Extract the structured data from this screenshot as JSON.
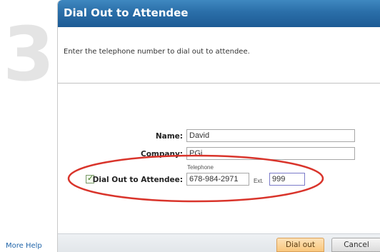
{
  "step": "3",
  "dialog": {
    "title": "Dial Out to Attendee",
    "instruction": "Enter the telephone number to dial out to attendee."
  },
  "form": {
    "name": {
      "label": "Name:",
      "value": "David"
    },
    "company": {
      "label": "Company:",
      "value": "PGi"
    },
    "dial_out": {
      "label": "Dial Out to Attendee:",
      "checked": true,
      "telephone_caption": "Telephone",
      "telephone_value": "678-984-2971",
      "ext_label": "Ext.",
      "ext_value": "999"
    }
  },
  "footer": {
    "more_help": "More Help",
    "dial_out_button": "Dial out",
    "cancel_button": "Cancel"
  },
  "colors": {
    "title_bar": "#2a6ea8",
    "highlight": "#d9342b",
    "link": "#2266aa",
    "primary_button": "#f9c77d"
  }
}
